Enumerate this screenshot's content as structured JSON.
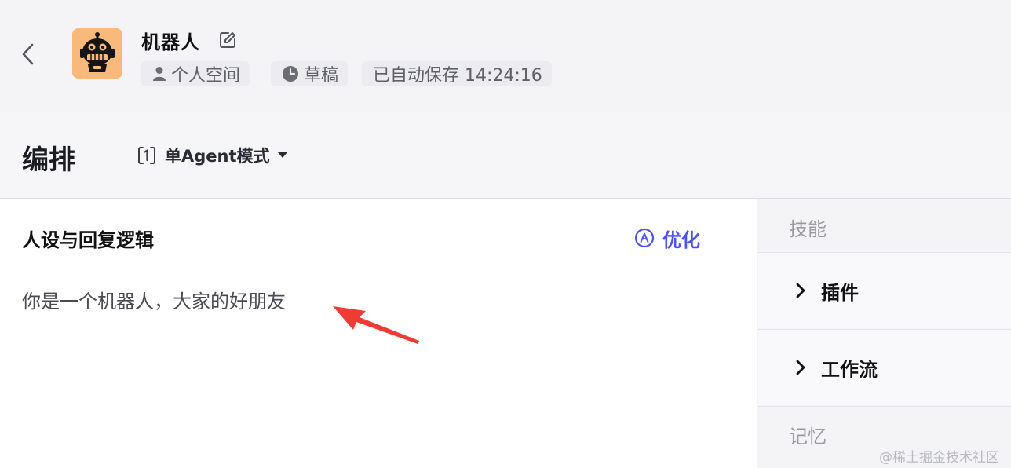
{
  "header": {
    "bot_name": "机器人",
    "tags": {
      "space": "个人空间",
      "status": "草稿",
      "autosave": "已自动保存 14:24:16"
    }
  },
  "toolbar": {
    "title": "编排",
    "mode_label": "单Agent模式"
  },
  "prompt_section": {
    "title": "人设与回复逻辑",
    "optimize_label": "优化",
    "content": "你是一个机器人，大家的好朋友"
  },
  "right_panel": {
    "skills_heading": "技能",
    "items": [
      {
        "label": "插件"
      },
      {
        "label": "工作流"
      }
    ],
    "memory_heading": "记忆"
  },
  "watermark": "@稀土掘金技术社区",
  "colors": {
    "accent": "#4d53e8",
    "annotation_arrow": "#ef3b36",
    "avatar_bg": "#f9b97a"
  },
  "icons": {
    "back": "chevron-left-icon",
    "edit": "edit-icon",
    "space": "user-icon",
    "status": "clock-icon",
    "mode": "agent-mode-icon",
    "optimize": "optimize-icon",
    "expand": "chevron-right-icon"
  }
}
